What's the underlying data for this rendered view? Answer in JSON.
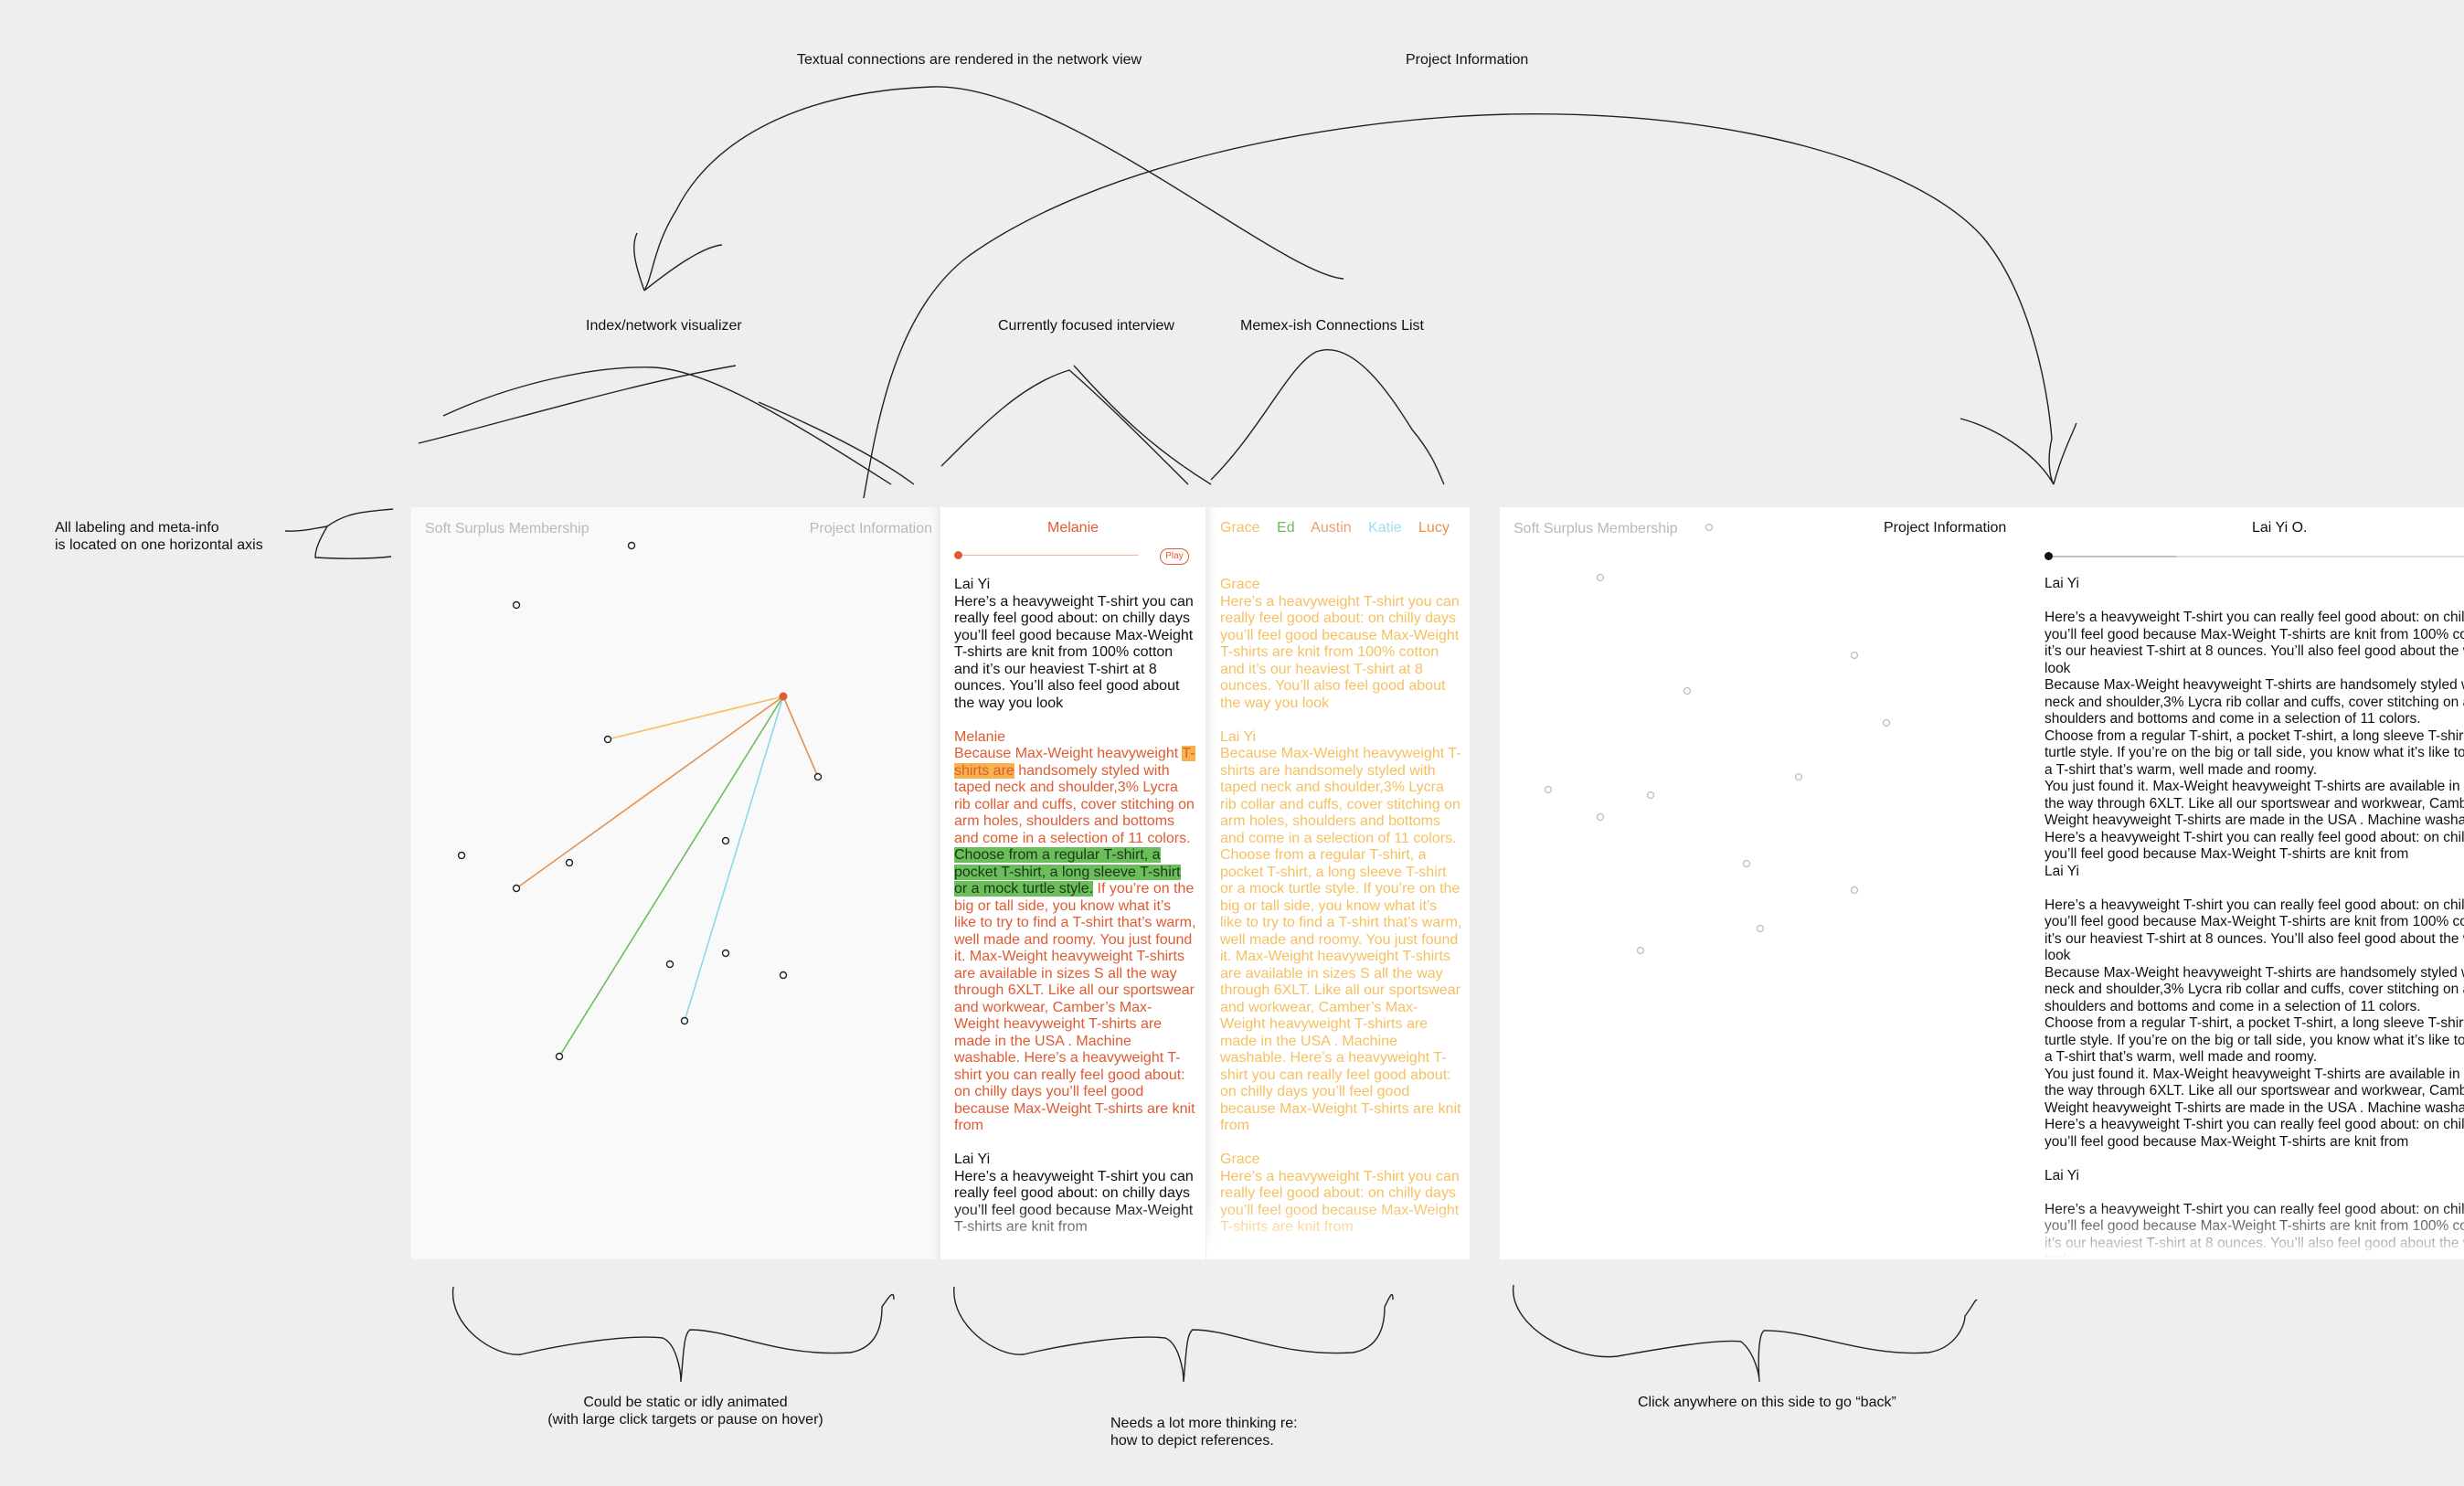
{
  "annotations": {
    "top_textual": "Textual connections are rendered in the network view",
    "top_project": "Project Information",
    "index_visualizer": "Index/network visualizer",
    "focused_interview": "Currently focused interview",
    "memex_list": "Memex-ish Connections List",
    "left_axis_line1": "All labeling and meta-info",
    "left_axis_line2": "is located on one horizontal axis",
    "bottom_static_line1": "Could be static or idly animated",
    "bottom_static_line2": "(with large click targets or pause on hover)",
    "bottom_refs_line1": "Needs a lot more thinking re:",
    "bottom_refs_line2": "how to depict references.",
    "bottom_back": "Click anywhere on this side to go “back”"
  },
  "network_panel": {
    "project_name": "Soft Surplus Membership",
    "project_info_link": "Project Information",
    "focused_node_color": "#e05a32",
    "edge_colors": {
      "grace": "#f6c060",
      "austin": "#e8904a",
      "ed": "#6cbd5b",
      "katie": "#8dd6ee",
      "lucy": "#e8904a"
    }
  },
  "interview_panel": {
    "title": "Melanie",
    "play_label": "Play",
    "playback_progress": 0.0,
    "blocks": [
      {
        "speaker": "Lai Yi",
        "text": "Here’s a heavyweight T-shirt you can really feel good about: on chilly days you’ll feel good because Max-Weight T-shirts are knit from 100% cotton and it’s our heaviest T-shirt at 8 ounces. You’ll also feel good about the way you look"
      },
      {
        "speaker": "Melanie",
        "pre": "Because Max-Weight heavyweight ",
        "hl_orange": "T-shirts are",
        "mid": " handsomely styled with taped neck and shoulder,3% Lycra rib collar and cuffs, cover stitching on arm holes, shoulders and bottoms and come in a selection of 11 colors. ",
        "hl_green": "Choose from a regular T-shirt, a pocket T-shirt, a long sleeve T-shirt or a mock turtle style.",
        "post": " If you’re on the big or tall side, you know what it’s like to try to find a T-shirt that’s warm, well made and roomy. You just found it. Max-Weight heavyweight T-shirts are available in sizes S all the way through 6XLT. Like all our sportswear and workwear, Camber’s Max-Weight heavyweight T-shirts are made in the USA .  Machine washable. Here’s a heavyweight T-shirt you can really feel good about: on chilly days you’ll feel good because Max-Weight T-shirts are knit from"
      },
      {
        "speaker": "Lai Yi",
        "text": "Here’s a heavyweight T-shirt you can really feel good about: on chilly days you’ll feel good because Max-Weight T-shirts are knit from"
      }
    ]
  },
  "connections_panel": {
    "tabs": [
      {
        "name": "Grace",
        "color": "#f6c060"
      },
      {
        "name": "Ed",
        "color": "#6cbd5b"
      },
      {
        "name": "Austin",
        "color": "#e8a070"
      },
      {
        "name": "Katie",
        "color": "#9ddcf0"
      },
      {
        "name": "Lucy",
        "color": "#e8904a"
      }
    ],
    "text_color": "#f6c060",
    "blocks": [
      {
        "speaker": "Grace",
        "text": "Here’s a heavyweight T-shirt you can really feel good about: on chilly days you’ll feel good because Max-Weight T-shirts are knit from 100% cotton and it’s our heaviest T-shirt at 8 ounces. You’ll also feel good about the way you look"
      },
      {
        "speaker": "Lai Yi",
        "text": "Because Max-Weight heavyweight T-shirts are handsomely styled with taped neck and shoulder,3% Lycra rib collar and cuffs, cover stitching on arm holes, shoulders and bottoms and come in a selection of 11 colors. Choose from a regular T-shirt, a pocket T-shirt, a long sleeve T-shirt or a mock turtle style. If you’re on the big or tall side, you know what it’s like to try to find a T-shirt that’s warm, well made and roomy. You just found it. Max-Weight heavyweight T-shirts are available in sizes S all the way through 6XLT. Like all our sportswear and workwear, Camber’s Max-Weight heavyweight T-shirts are made in the USA .  Machine washable. Here’s a heavyweight T-shirt you can really feel good about: on chilly days you’ll feel good because Max-Weight T-shirts are knit from"
      },
      {
        "speaker": "Grace",
        "text": "Here’s a heavyweight T-shirt you can really feel good about: on chilly days you’ll feel good because Max-Weight T-shirts are knit from"
      }
    ]
  },
  "right_panel": {
    "project_name": "Soft Surplus Membership",
    "project_info": "Project Information",
    "interviewee": "Lai Yi O.",
    "speaker1": "Lai Yi",
    "text1": "Here’s a heavyweight T-shirt you can really feel good about: on chilly days you’ll feel good because Max-Weight T-shirts are knit from 100% cotton and it’s our heaviest T-shirt at 8 ounces. You’ll also feel good about the way you look\nBecause Max-Weight heavyweight T-shirts are handsomely styled with taped neck and shoulder,3% Lycra  rib collar and cuffs, cover stitching on arm holes, shoulders and bottoms and come in a selection of 11 colors.\nChoose from a regular T-shirt, a pocket T-shirt, a long sleeve T-shirt or a mock turtle style. If you’re on the big or tall side, you know what it’s like to try to find a T-shirt that’s warm, well made and roomy.\nYou just found it. Max-Weight heavyweight T-shirts are available in sizes S all the way through 6XLT. Like all our sportswear and workwear, Camber’s Max-Weight heavyweight T-shirts are made in the USA .  Machine washable.\nHere’s a heavyweight T-shirt you can really feel good about: on chilly days you’ll feel good because Max-Weight T-shirts are knit from",
    "speaker2": "Lai Yi",
    "text2": "Here’s a heavyweight T-shirt you can really feel good about: on chilly days you’ll feel good because Max-Weight T-shirts are knit from 100% cotton and it’s our heaviest T-shirt at 8 ounces. You’ll also feel good about the way you look\nBecause Max-Weight heavyweight T-shirts are handsomely styled with taped neck and shoulder,3% Lycra  rib collar and cuffs, cover stitching on arm holes, shoulders and bottoms and come in a selection of 11 colors.\nChoose from a regular T-shirt, a pocket T-shirt, a long sleeve T-shirt or a mock turtle style. If you’re on the big or tall side, you know what it’s like to try to find a T-shirt that’s warm, well made and roomy.\nYou just found it. Max-Weight heavyweight T-shirts are available in sizes S all the way through 6XLT. Like all our sportswear and workwear, Camber’s Max-Weight heavyweight T-shirts are made in the USA .  Machine washable.\nHere’s a heavyweight T-shirt you can really feel good about: on chilly days you’ll feel good because Max-Weight T-shirts are knit from",
    "speaker3": "Lai Yi",
    "text3": "Here’s a heavyweight T-shirt you can really feel good about: on chilly days you’ll feel good because Max-Weight T-shirts are knit from 100% cotton and it’s our heaviest T-shirt at 8 ounces. You’ll also feel good about the way you look"
  }
}
